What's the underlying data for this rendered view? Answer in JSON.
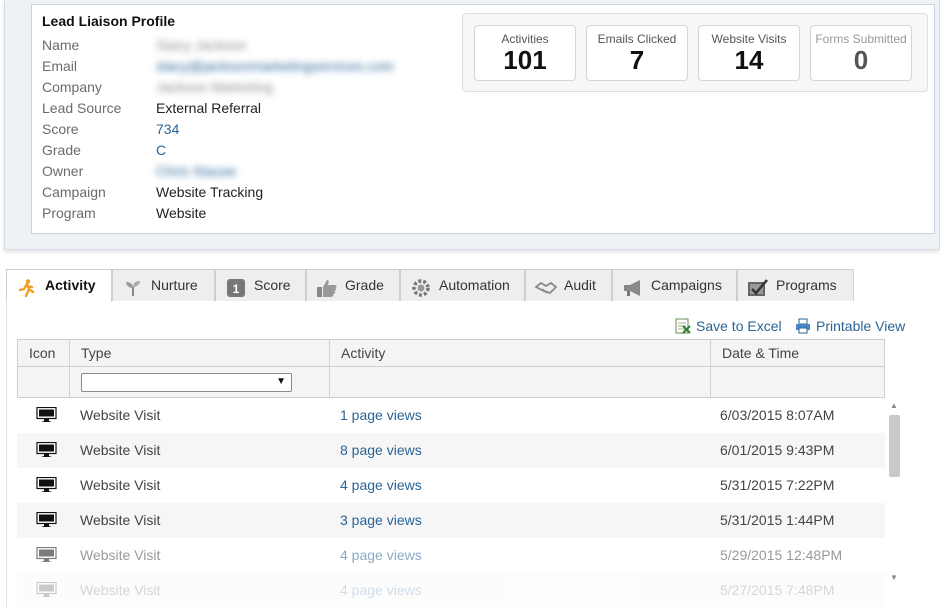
{
  "profile": {
    "title": "Lead Liaison Profile",
    "fields": [
      {
        "label": "Name",
        "value": "Stacy Jackson"
      },
      {
        "label": "Email",
        "value": "stacy@jacksonmarketingservices.com"
      },
      {
        "label": "Company",
        "value": "Jackson Marketing"
      },
      {
        "label": "Lead Source",
        "value": "External Referral"
      },
      {
        "label": "Score",
        "value": "734"
      },
      {
        "label": "Grade",
        "value": "C"
      },
      {
        "label": "Owner",
        "value": "Chris Stause"
      },
      {
        "label": "Campaign",
        "value": "Website Tracking"
      },
      {
        "label": "Program",
        "value": "Website"
      }
    ]
  },
  "stats": [
    {
      "label": "Activities",
      "value": "101"
    },
    {
      "label": "Emails Clicked",
      "value": "7"
    },
    {
      "label": "Website Visits",
      "value": "14"
    },
    {
      "label": "Forms Submitted",
      "value": "0"
    }
  ],
  "tabs": [
    {
      "label": "Activity",
      "icon": "running-person-icon",
      "active": true
    },
    {
      "label": "Nurture",
      "icon": "sprout-icon"
    },
    {
      "label": "Score",
      "icon": "score-badge-icon"
    },
    {
      "label": "Grade",
      "icon": "thumbs-up-icon"
    },
    {
      "label": "Automation",
      "icon": "gear-icon"
    },
    {
      "label": "Audit",
      "icon": "handshake-icon"
    },
    {
      "label": "Campaigns",
      "icon": "megaphone-icon"
    },
    {
      "label": "Programs",
      "icon": "checklist-icon"
    }
  ],
  "toolbar": {
    "save_excel": "Save to Excel",
    "printable": "Printable View"
  },
  "grid": {
    "columns": [
      "Icon",
      "Type",
      "Activity",
      "Date & Time"
    ],
    "type_filter_value": "",
    "rows": [
      {
        "icon": "monitor-icon",
        "type": "Website Visit",
        "activity": "1 page views",
        "datetime": "6/03/2015 8:07AM"
      },
      {
        "icon": "monitor-icon",
        "type": "Website Visit",
        "activity": "8 page views",
        "datetime": "6/01/2015 9:43PM"
      },
      {
        "icon": "monitor-icon",
        "type": "Website Visit",
        "activity": "4 page views",
        "datetime": "5/31/2015 7:22PM"
      },
      {
        "icon": "monitor-icon",
        "type": "Website Visit",
        "activity": "3 page views",
        "datetime": "5/31/2015 1:44PM"
      },
      {
        "icon": "monitor-icon",
        "type": "Website Visit",
        "activity": "4 page views",
        "datetime": "5/29/2015 12:48PM"
      },
      {
        "icon": "monitor-icon",
        "type": "Website Visit",
        "activity": "4 page views",
        "datetime": "5/27/2015 7:48PM"
      }
    ]
  },
  "colors": {
    "link": "#2a6496",
    "panel_bg": "#eef2f7",
    "tab_bg": "#eeeeee"
  }
}
